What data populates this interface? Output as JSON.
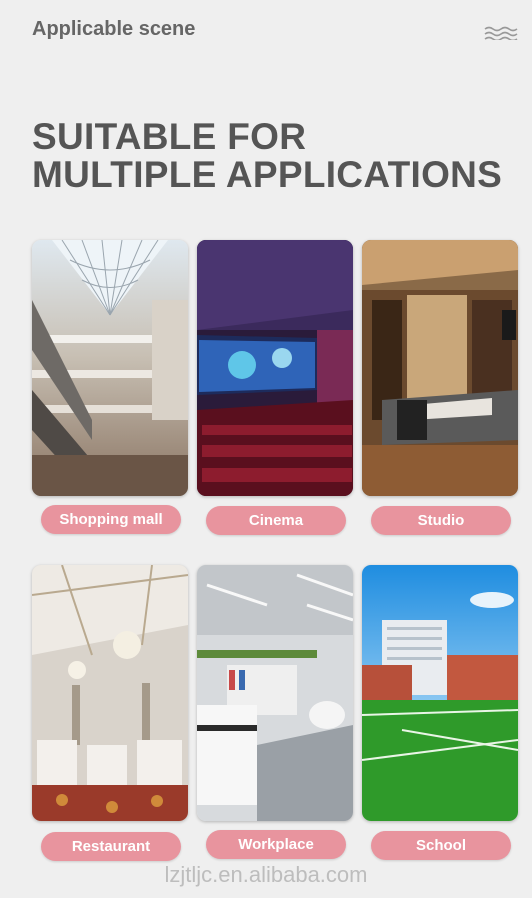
{
  "header": {
    "title": "Applicable scene",
    "menu_icon": "wave-lines-icon"
  },
  "headline": {
    "line1": "SUITABLE FOR",
    "line2": "MULTIPLE APPLICATIONS"
  },
  "scenes": [
    {
      "label": "Shopping mall"
    },
    {
      "label": "Cinema"
    },
    {
      "label": "Studio"
    },
    {
      "label": "Restaurant"
    },
    {
      "label": "Workplace"
    },
    {
      "label": "School"
    }
  ],
  "colors": {
    "background": "#efefef",
    "pill": "#e8949e",
    "heading": "#555555"
  },
  "footer": {
    "watermark": "lzjtljc.en.alibaba.com"
  }
}
